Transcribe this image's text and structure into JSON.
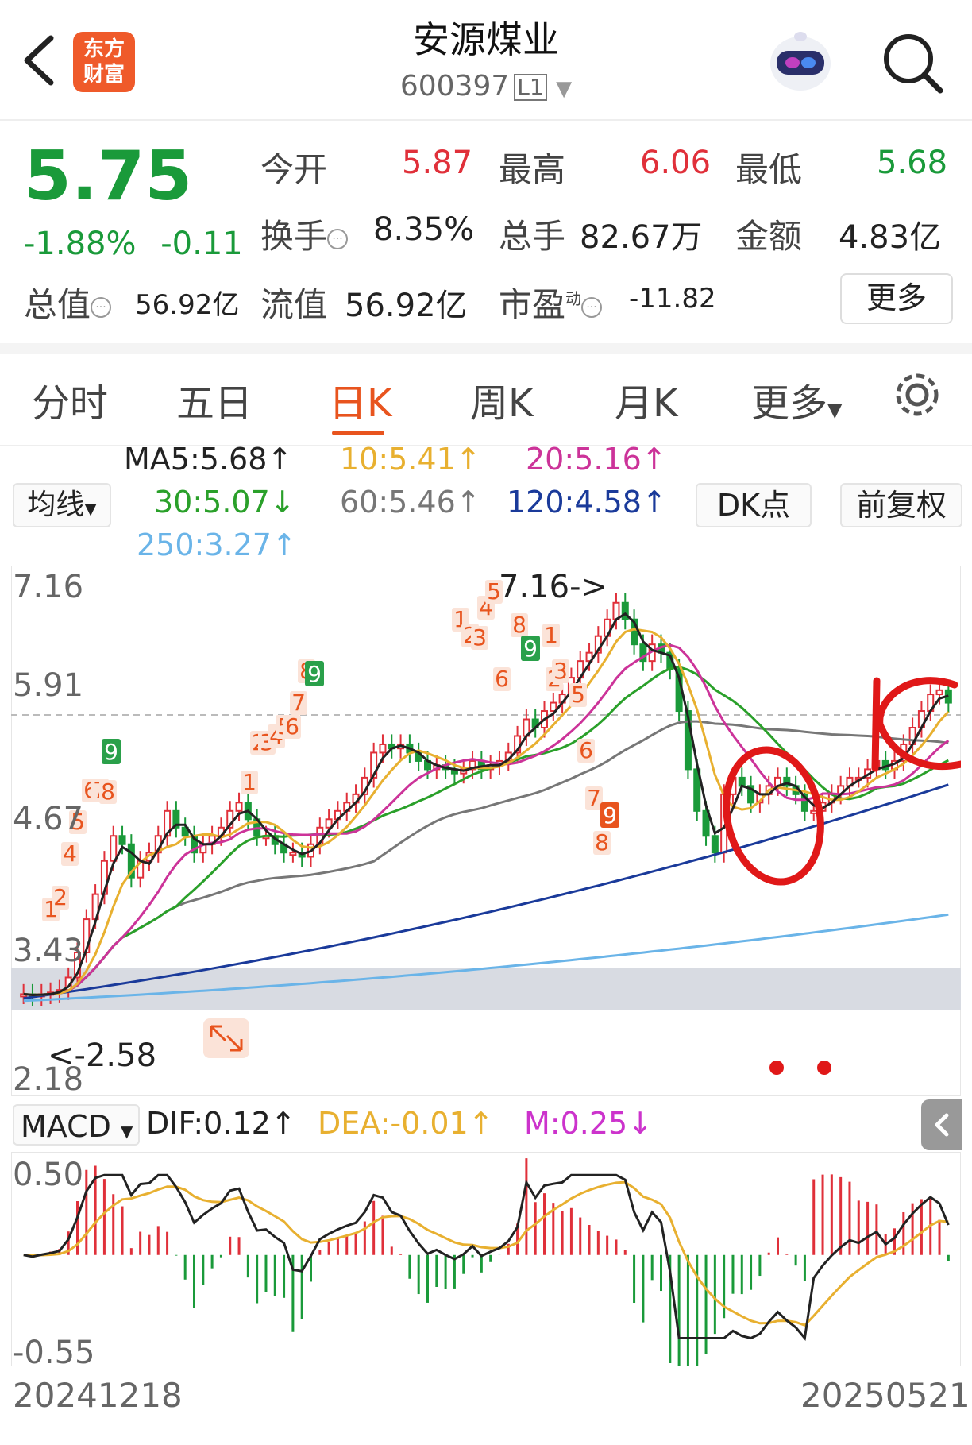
{
  "header": {
    "title": "安源煤业",
    "code": "600397",
    "level": "L1",
    "logo_line1": "东方",
    "logo_line2": "财富"
  },
  "quote": {
    "price": "5.75",
    "change_pct": "-1.88%",
    "change": "-0.11",
    "open_label": "今开",
    "open": "5.87",
    "high_label": "最高",
    "high": "6.06",
    "low_label": "最低",
    "low": "5.68",
    "turnover_label": "换手",
    "turnover": "8.35%",
    "volume_label": "总手",
    "volume": "82.67万",
    "amount_label": "金额",
    "amount": "4.83亿",
    "mktcap_label": "总值",
    "mktcap": "56.92亿",
    "float_label": "流值",
    "float": "56.92亿",
    "pe_label": "市盈",
    "pe_sup": "动",
    "pe": "-11.82",
    "more": "更多"
  },
  "tabs": [
    "分时",
    "五日",
    "日K",
    "周K",
    "月K",
    "更多"
  ],
  "active_tab": "日K",
  "ma": {
    "button": "均线",
    "ma5": "MA5:5.68↑",
    "ma10": "10:5.41↑",
    "ma20": "20:5.16↑",
    "ma30": "30:5.07↓",
    "ma60": "60:5.46↑",
    "ma120": "120:4.58↑",
    "ma250": "250:3.27↑",
    "dk": "DK点",
    "adjust": "前复权"
  },
  "colors": {
    "up": "#e0303a",
    "down": "#1a9a3a",
    "accent": "#e8541e",
    "ma5": "#222222",
    "ma10": "#e8b030",
    "ma20": "#cc3399",
    "ma30": "#2aa02a",
    "ma60": "#777777",
    "ma120": "#1a3a9a",
    "ma250": "#6ab4e8"
  },
  "chart": {
    "y_labels": [
      "7.16",
      "5.91",
      "4.67",
      "3.43",
      "2.18"
    ],
    "high_note": "7.16->",
    "low_note": "<-2.58",
    "macd_label": "MACD",
    "dif": "DIF:0.12↑",
    "dea": "DEA:-0.01↑",
    "m": "M:0.25↓",
    "macd_y": [
      "0.50",
      "-0.55"
    ],
    "date_start": "20241218",
    "date_end": "20250521",
    "td_numbers": [
      {
        "t": "1",
        "c": "o"
      },
      {
        "t": "2",
        "c": "o"
      },
      {
        "t": "4",
        "c": "o"
      },
      {
        "t": "5",
        "c": "o"
      },
      {
        "t": "6",
        "c": "o"
      },
      {
        "t": "7",
        "c": "o"
      },
      {
        "t": "8",
        "c": "o"
      },
      {
        "t": "9",
        "c": "g"
      },
      {
        "t": "1",
        "c": "o"
      },
      {
        "t": "2",
        "c": "o"
      },
      {
        "t": "3",
        "c": "o"
      },
      {
        "t": "4",
        "c": "o"
      },
      {
        "t": "5",
        "c": "o"
      },
      {
        "t": "6",
        "c": "o"
      },
      {
        "t": "7",
        "c": "o"
      },
      {
        "t": "8",
        "c": "o"
      },
      {
        "t": "9",
        "c": "g"
      },
      {
        "t": "1",
        "c": "o"
      },
      {
        "t": "2",
        "c": "o"
      },
      {
        "t": "3",
        "c": "o"
      },
      {
        "t": "4",
        "c": "o"
      },
      {
        "t": "5",
        "c": "o"
      },
      {
        "t": "6",
        "c": "o"
      },
      {
        "t": "8",
        "c": "o"
      },
      {
        "t": "9",
        "c": "g"
      },
      {
        "t": "1",
        "c": "o"
      },
      {
        "t": "2",
        "c": "o"
      },
      {
        "t": "3",
        "c": "o"
      },
      {
        "t": "5",
        "c": "o"
      },
      {
        "t": "6",
        "c": "o"
      },
      {
        "t": "7",
        "c": "o"
      },
      {
        "t": "9",
        "c": "r"
      },
      {
        "t": "8",
        "c": "o"
      }
    ]
  }
}
